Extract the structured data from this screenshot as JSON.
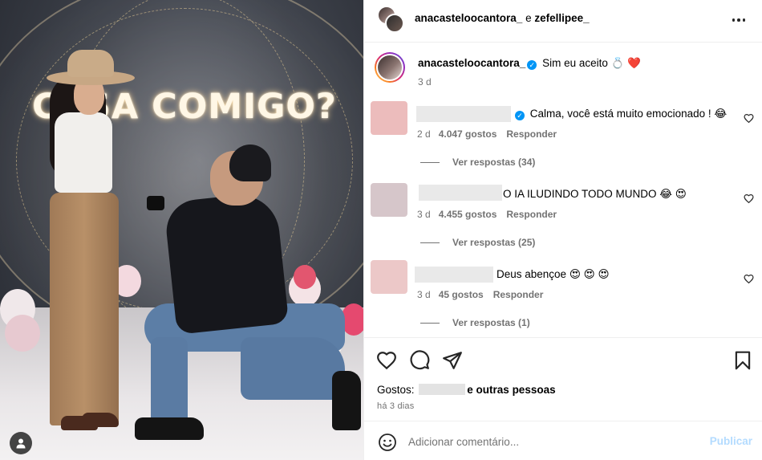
{
  "header": {
    "user1": "anacasteloocantora_",
    "joiner": " e ",
    "user2": "zefellipee_",
    "more_icon": "more-horizontal-icon"
  },
  "photo": {
    "sign_text": "CASA COMIGO?",
    "account_icon": "user-silhouette-icon"
  },
  "caption": {
    "username": "anacasteloocantora_",
    "text": "Sim eu aceito 💍 ❤️",
    "time": "3 d"
  },
  "comments": [
    {
      "verified": true,
      "text": "Calma, você está muito emocionado ! 😂",
      "time": "2 d",
      "likes": "4.047 gostos",
      "reply": "Responder",
      "replies": "Ver respostas (34)",
      "avatar_color": "#ecbcbc"
    },
    {
      "verified": false,
      "text": "O IA ILUDINDO TODO MUNDO 😂 😍",
      "time": "3 d",
      "likes": "4.455 gostos",
      "reply": "Responder",
      "replies": "Ver respostas (25)",
      "avatar_color": "#d6c6ca"
    },
    {
      "verified": false,
      "text": "Deus abençoe 😍 😍 😍",
      "time": "3 d",
      "likes": "45 gostos",
      "reply": "Responder",
      "replies": "Ver respostas (1)",
      "avatar_color": "#ecc8c8"
    }
  ],
  "actions": {
    "like_icon": "heart-icon",
    "comment_icon": "comment-bubble-icon",
    "share_icon": "paper-plane-icon",
    "save_icon": "bookmark-icon"
  },
  "likes": {
    "prefix": "Gostos:",
    "suffix": "e outras pessoas"
  },
  "posted_ago": "há 3 dias",
  "comment_bar": {
    "emoji_icon": "smiley-icon",
    "placeholder": "Adicionar comentário...",
    "publish_label": "Publicar"
  },
  "colors": {
    "link_disabled": "#b3dbff",
    "verified": "#0095f6",
    "secondary_text": "#737373"
  }
}
